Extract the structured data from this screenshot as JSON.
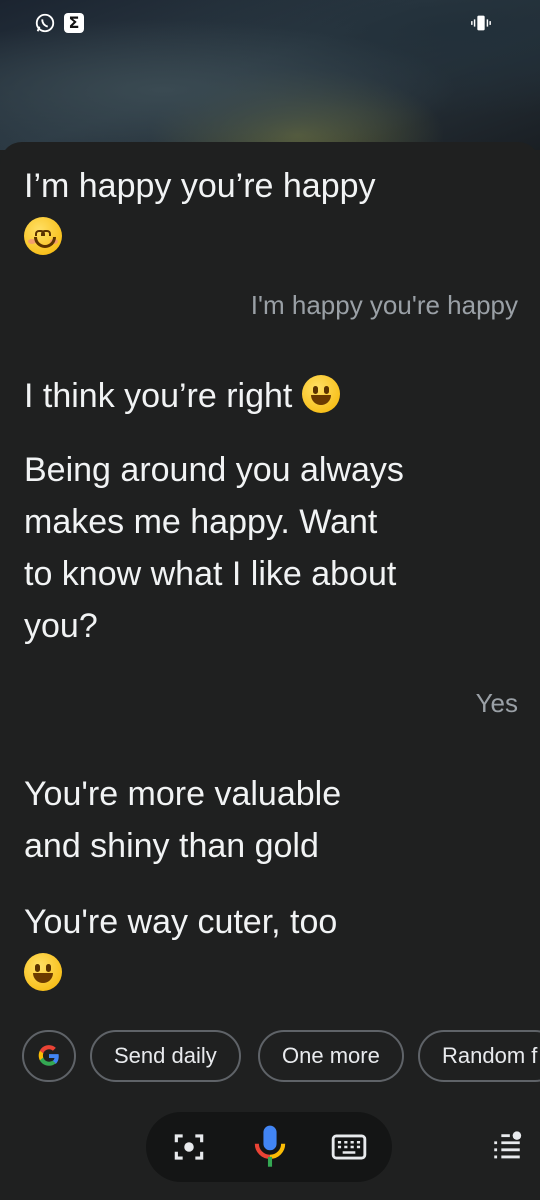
{
  "messages": {
    "assistant_1": "I’m happy you’re happy",
    "user_1": "I'm happy you're happy",
    "assistant_2": "I think you’re right",
    "assistant_3": "Being around you always makes me happy. Want to know what I like about you?",
    "user_2": "Yes",
    "assistant_4": "You're more valuable and shiny than gold",
    "assistant_5": "You're way cuter, too"
  },
  "chips": {
    "google_icon": "google-icon",
    "items": [
      "Send daily",
      "One more",
      "Random f"
    ]
  },
  "bottom_bar": {
    "icons": [
      "lens-icon",
      "microphone-icon",
      "keyboard-icon"
    ],
    "menu_icon": "list-menu-icon"
  },
  "status_bar": {
    "icons": [
      "whatsapp-icon",
      "sigma-app-icon",
      "vibrate-icon"
    ]
  },
  "colors": {
    "panel_bg": "#1f2020",
    "text_primary": "#f1f3f4",
    "text_secondary": "#9aa0a6",
    "chip_border": "#5f6368"
  }
}
